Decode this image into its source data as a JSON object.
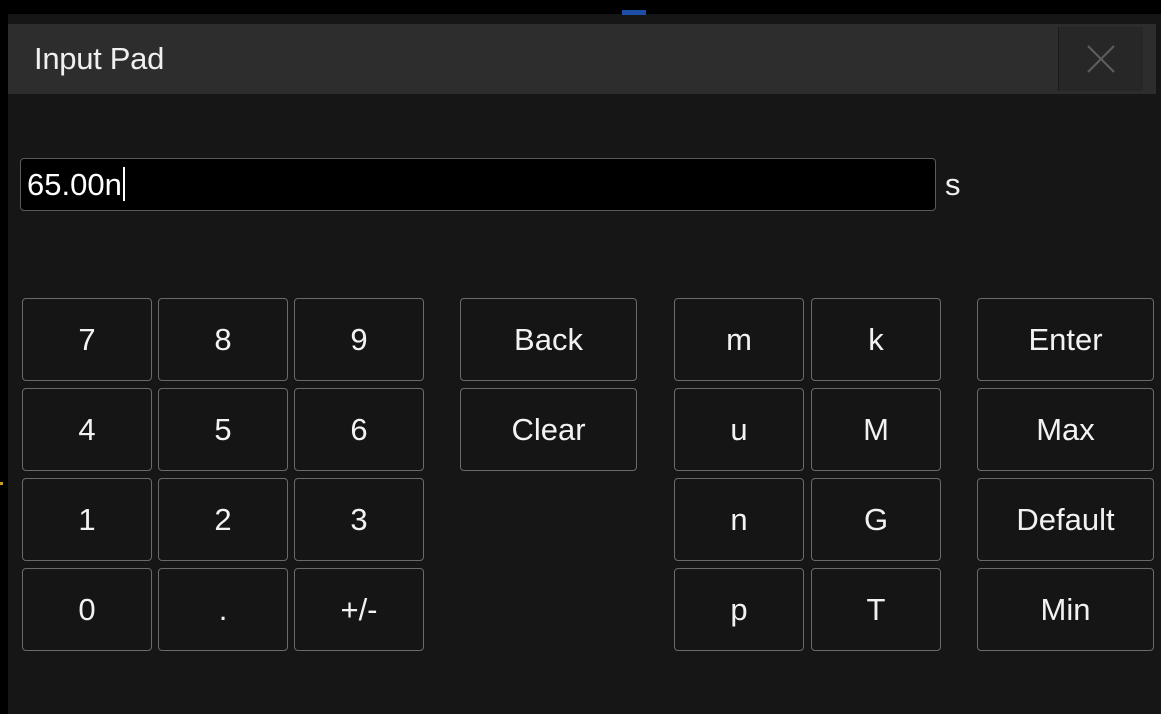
{
  "dialog": {
    "title": "Input Pad",
    "close_icon": "close-x-icon"
  },
  "field": {
    "value": "65.00n",
    "unit": "s"
  },
  "keypad": {
    "digits": [
      "7",
      "8",
      "9",
      "4",
      "5",
      "6",
      "1",
      "2",
      "3",
      "0",
      ".",
      "+/-"
    ],
    "edit": [
      "Back",
      "Clear"
    ],
    "prefixes_left": [
      "m",
      "u",
      "n",
      "p"
    ],
    "prefixes_right": [
      "k",
      "M",
      "G",
      "T"
    ],
    "actions": [
      "Enter",
      "Max",
      "Default",
      "Min"
    ]
  },
  "colors": {
    "background": "#161616",
    "title_bar": "#2d2d2d",
    "key_border": "#6a6a6a",
    "text": "#f2f2f2"
  }
}
